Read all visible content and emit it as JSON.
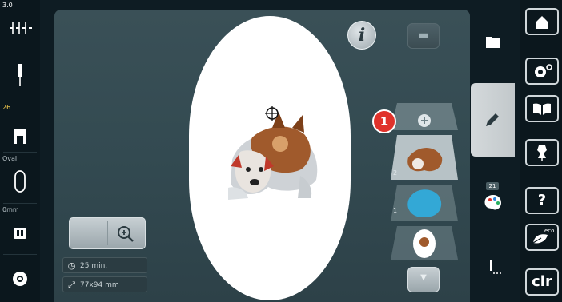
{
  "status_bar": {
    "stitch_length": "3.0",
    "presser_foot": "26",
    "hoop": "Oval",
    "feed_dog": "0mm"
  },
  "stage": {
    "time_label": "25 min.",
    "size_label": "77x94 mm",
    "badge": "1",
    "layers": [
      {
        "index": "2"
      },
      {
        "index": "1"
      }
    ]
  },
  "tabs": {
    "colors_count": "21"
  },
  "right_toolbar": {
    "clr_label": "clr",
    "help_label": "?",
    "eco_label": "eco"
  },
  "colors": {
    "accent_badge": "#e0322b",
    "stage_bg": "#3a5057",
    "hoop": "#ffffff"
  },
  "icons": [
    "stitch-icon",
    "needle-icon",
    "presser-foot-icon",
    "hoop-icon",
    "feed-dog-icon",
    "bobbin-icon",
    "info-icon",
    "zoom-icon",
    "clock-icon",
    "size-icon",
    "folder-icon",
    "pencil-icon",
    "palette-icon",
    "needle-stitch-icon",
    "home-icon",
    "settings-icon",
    "book-icon",
    "dress-form-icon",
    "help-icon",
    "eco-icon",
    "clear-icon"
  ]
}
